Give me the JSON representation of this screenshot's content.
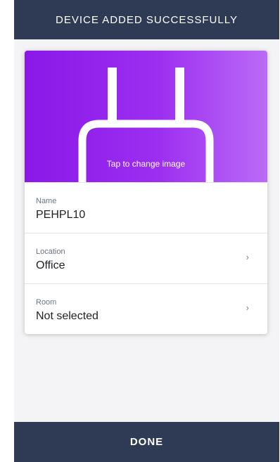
{
  "header": {
    "title": "DEVICE ADDED SUCCESSFULLY"
  },
  "device": {
    "image_caption": "Tap to change image",
    "image_icon": "plug-icon",
    "hero_colors": [
      "#8a18e8",
      "#bb6bf7"
    ]
  },
  "fields": [
    {
      "label": "Name",
      "value": "PEHPL10"
    },
    {
      "label": "Location",
      "value": "Office",
      "chevron": "›"
    },
    {
      "label": "Room",
      "value": "Not selected",
      "chevron": "›"
    }
  ],
  "footer": {
    "done_label": "DONE"
  },
  "colors": {
    "bar": "#2f3a55",
    "background": "#f4f4f6"
  }
}
